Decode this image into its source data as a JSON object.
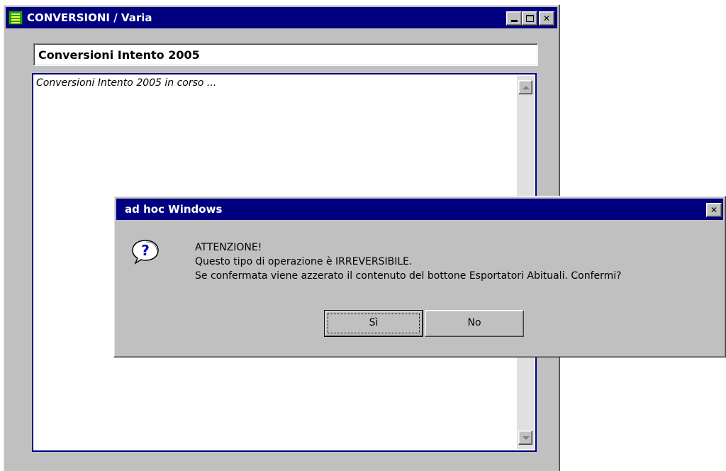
{
  "main_window": {
    "title": "CONVERSIONI / Varia",
    "caption": "Conversioni Intento 2005",
    "log_text": "Conversioni Intento 2005 in corso ...",
    "controls": {
      "close_glyph": "✕"
    }
  },
  "dialog": {
    "title": "ad hoc Windows",
    "close_glyph": "✕",
    "icon": "question-icon",
    "line1": "ATTENZIONE!",
    "line2": "Questo tipo di operazione è IRREVERSIBILE.",
    "line3": "Se confermata viene azzerato il contenuto del bottone Esportatori Abituali. Confermi?",
    "yes_label": "Sì",
    "no_label": "No"
  },
  "colors": {
    "titlebar": "#000080",
    "face": "#c0c0c0",
    "log_border": "#000080"
  }
}
